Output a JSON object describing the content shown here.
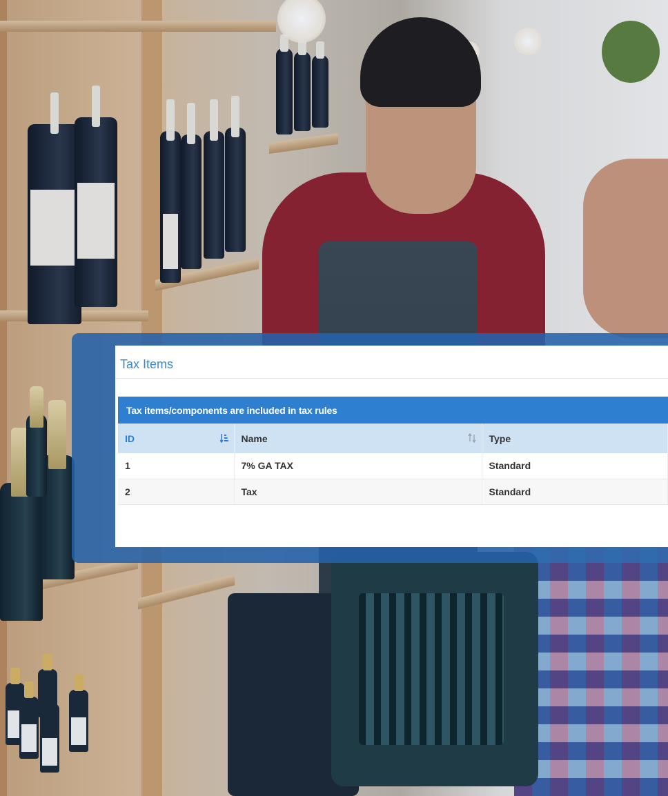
{
  "panel": {
    "title": "Tax Items"
  },
  "table": {
    "caption": "Tax items/components are included in tax rules",
    "columns": [
      {
        "label": "ID",
        "sort": "ascending"
      },
      {
        "label": "Name",
        "sort": "sortable"
      },
      {
        "label": "Type",
        "sort": "none"
      }
    ],
    "rows": [
      {
        "id": "1",
        "name": "7% GA TAX",
        "type": "Standard"
      },
      {
        "id": "2",
        "name": "Tax",
        "type": "Standard"
      }
    ]
  },
  "colors": {
    "accent_blue": "#2f7fd0",
    "header_blue": "#cfe2f3",
    "title_blue": "#3a86c8",
    "card_blue": "#2462aa"
  },
  "icons": {
    "id_sort": "sort-ascending-icon",
    "name_sort": "sort-both-icon"
  }
}
